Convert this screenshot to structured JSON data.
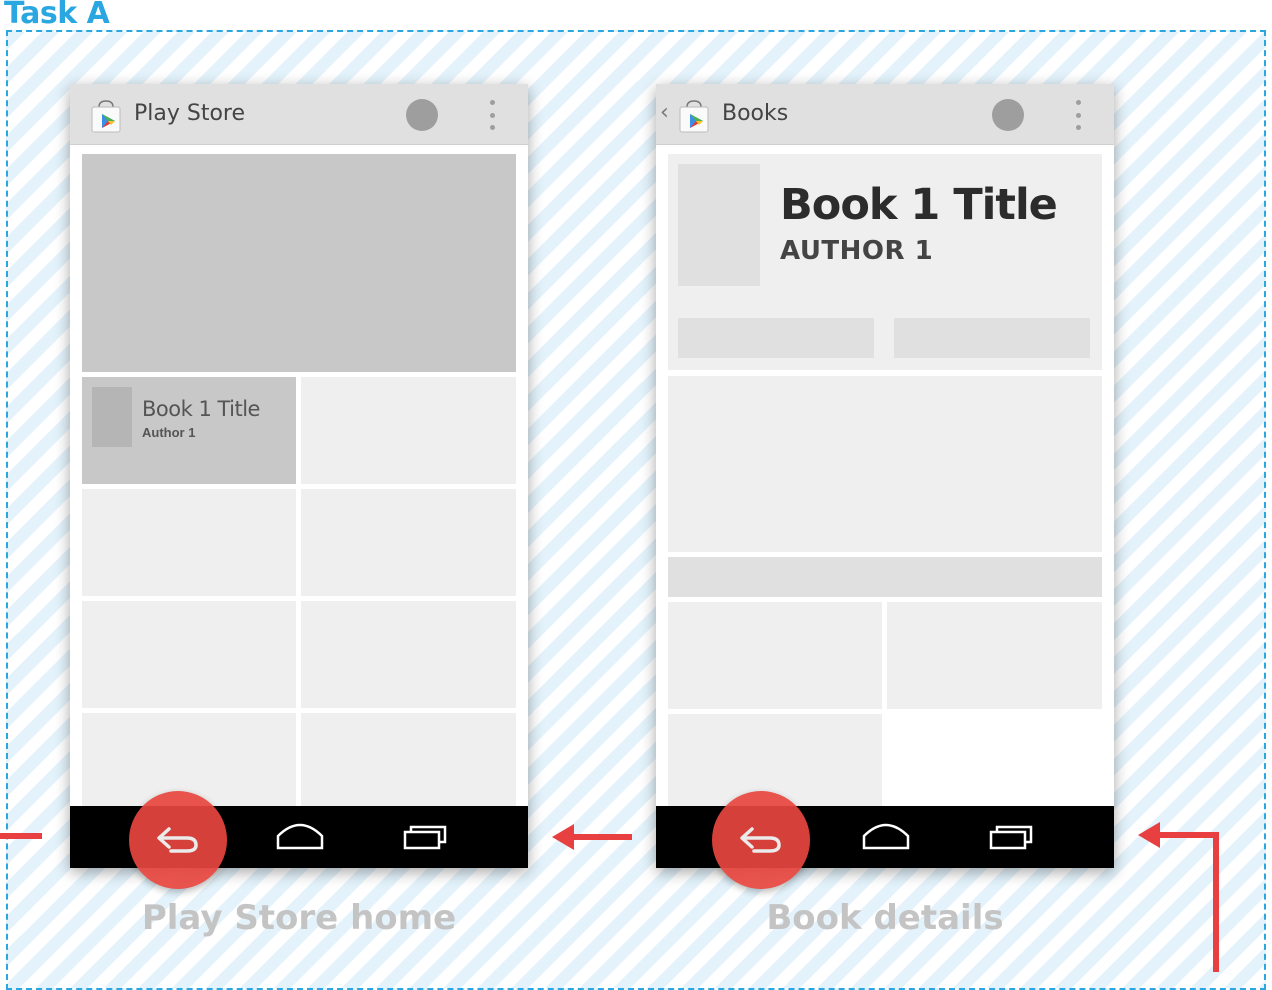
{
  "task": {
    "label": "Task A"
  },
  "screens": [
    {
      "app_title": "Play Store",
      "featured_book": {
        "title": "Book 1 Title",
        "author": "Author 1"
      },
      "caption": "Play Store home"
    },
    {
      "back_glyph": "‹",
      "app_title": "Books",
      "book": {
        "title": "Book 1 Title",
        "author": "AUTHOR 1"
      },
      "caption": "Book details"
    }
  ],
  "icons": {
    "app": "play-store-bag-icon",
    "action": "circle-action-icon",
    "overflow": "overflow-menu-icon",
    "back": "back-icon",
    "home": "home-icon",
    "recents": "recents-icon",
    "arrow": "flow-arrow"
  },
  "colors": {
    "accent_blue": "#2aa6e0",
    "fab_red": "#e8463f",
    "arrow_red": "#e84040",
    "nav_bar": "#000000"
  }
}
